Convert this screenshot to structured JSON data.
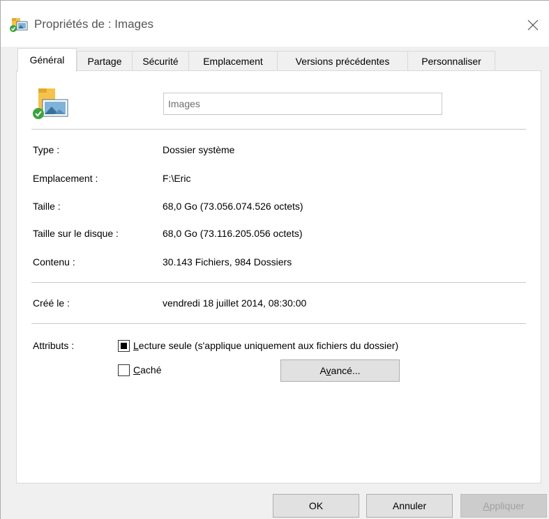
{
  "window": {
    "title": "Propriétés de : Images",
    "close_icon": "close-icon"
  },
  "tabs": [
    {
      "label": "Général",
      "active": true
    },
    {
      "label": "Partage",
      "active": false
    },
    {
      "label": "Sécurité",
      "active": false
    },
    {
      "label": "Emplacement",
      "active": false
    },
    {
      "label": "Versions précédentes",
      "active": false
    },
    {
      "label": "Personnaliser",
      "active": false
    }
  ],
  "general": {
    "folder_icon": "pictures-folder-icon",
    "name_value": "Images",
    "rows": [
      {
        "label": "Type :",
        "value": "Dossier système"
      },
      {
        "label": "Emplacement :",
        "value": "F:\\Eric"
      },
      {
        "label": "Taille :",
        "value": "68,0 Go (73.056.074.526 octets)"
      },
      {
        "label": "Taille sur le disque :",
        "value": "68,0 Go (73.116.205.056 octets)"
      },
      {
        "label": "Contenu :",
        "value": "30.143 Fichiers, 984 Dossiers"
      }
    ],
    "created": {
      "label": "Créé le :",
      "value": "vendredi 18 juillet 2014, 08:30:00"
    },
    "attributes": {
      "label": "Attributs :",
      "readonly": {
        "label_first": "L",
        "label_rest": "ecture seule (s'applique uniquement aux fichiers du dossier)",
        "state": "indeterminate"
      },
      "hidden": {
        "label_first": "C",
        "label_rest": "aché",
        "checked": false
      },
      "advanced_before": "A",
      "advanced_u": "v",
      "advanced_after": "ancé..."
    }
  },
  "footer": {
    "ok": "OK",
    "cancel": "Annuler",
    "apply_first": "A",
    "apply_rest": "ppliquer"
  }
}
